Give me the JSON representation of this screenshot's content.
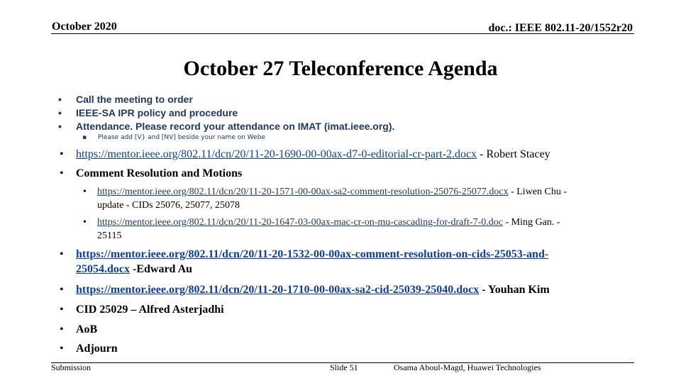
{
  "header": {
    "date": "October 2020",
    "doc_id": "doc.: IEEE 802.11-20/1552r20"
  },
  "title": "October 27 Teleconference Agenda",
  "bullet_glyph": "•",
  "sub_bullet_glyph": "▪",
  "agenda": {
    "call_to_order": "Call the meeting to order",
    "ipr_policy": "IEEE-SA IPR policy and procedure",
    "attendance": "Attendance. Please record your attendance on IMAT (imat.ieee.org).",
    "attendance_note": "Please add [V} and [NV] beside your name on Webe",
    "item_editorial": {
      "link": "https://mentor.ieee.org/802.11/dcn/20/11-20-1690-00-00ax-d7-0-editorial-cr-part-2.docx",
      "suffix": " - Robert Stacey"
    },
    "comment_resolution": "Comment Resolution and Motions",
    "sub_items": [
      {
        "link": "https://mentor.ieee.org/802.11/dcn/20/11-20-1571-00-00ax-sa2-comment-resolution-25076-25077.docx",
        "suffix": " - Liwen Chu -",
        "continuation": "update  - CIDs 25076, 25077,  25078"
      },
      {
        "link": "https://mentor.ieee.org/802.11/dcn/20/11-20-1647-03-00ax-mac-cr-on-mu-cascading-for-draft-7-0.doc",
        "suffix": " - Ming Gan.  -",
        "continuation": "25115"
      }
    ],
    "item_25053": {
      "link_line1": "https://mentor.ieee.org/802.11/dcn/20/11-20-1532-00-00ax-comment-resolution-on-cids-25053-and-",
      "link_line2": "25054.docx",
      "suffix": " -Edward Au"
    },
    "item_25039": {
      "link": "https://mentor.ieee.org/802.11/dcn/20/11-20-1710-00-00ax-sa2-cid-25039-25040.docx",
      "suffix": " - Youhan Kim"
    },
    "cid_25029": "CID 25029 – Alfred Asterjadhi",
    "aob": "AoB",
    "adjourn": "Adjourn"
  },
  "footer": {
    "left": "Submission",
    "center": "Slide 51",
    "right": "Osama Aboul-Magd, Huawei Technologies"
  }
}
